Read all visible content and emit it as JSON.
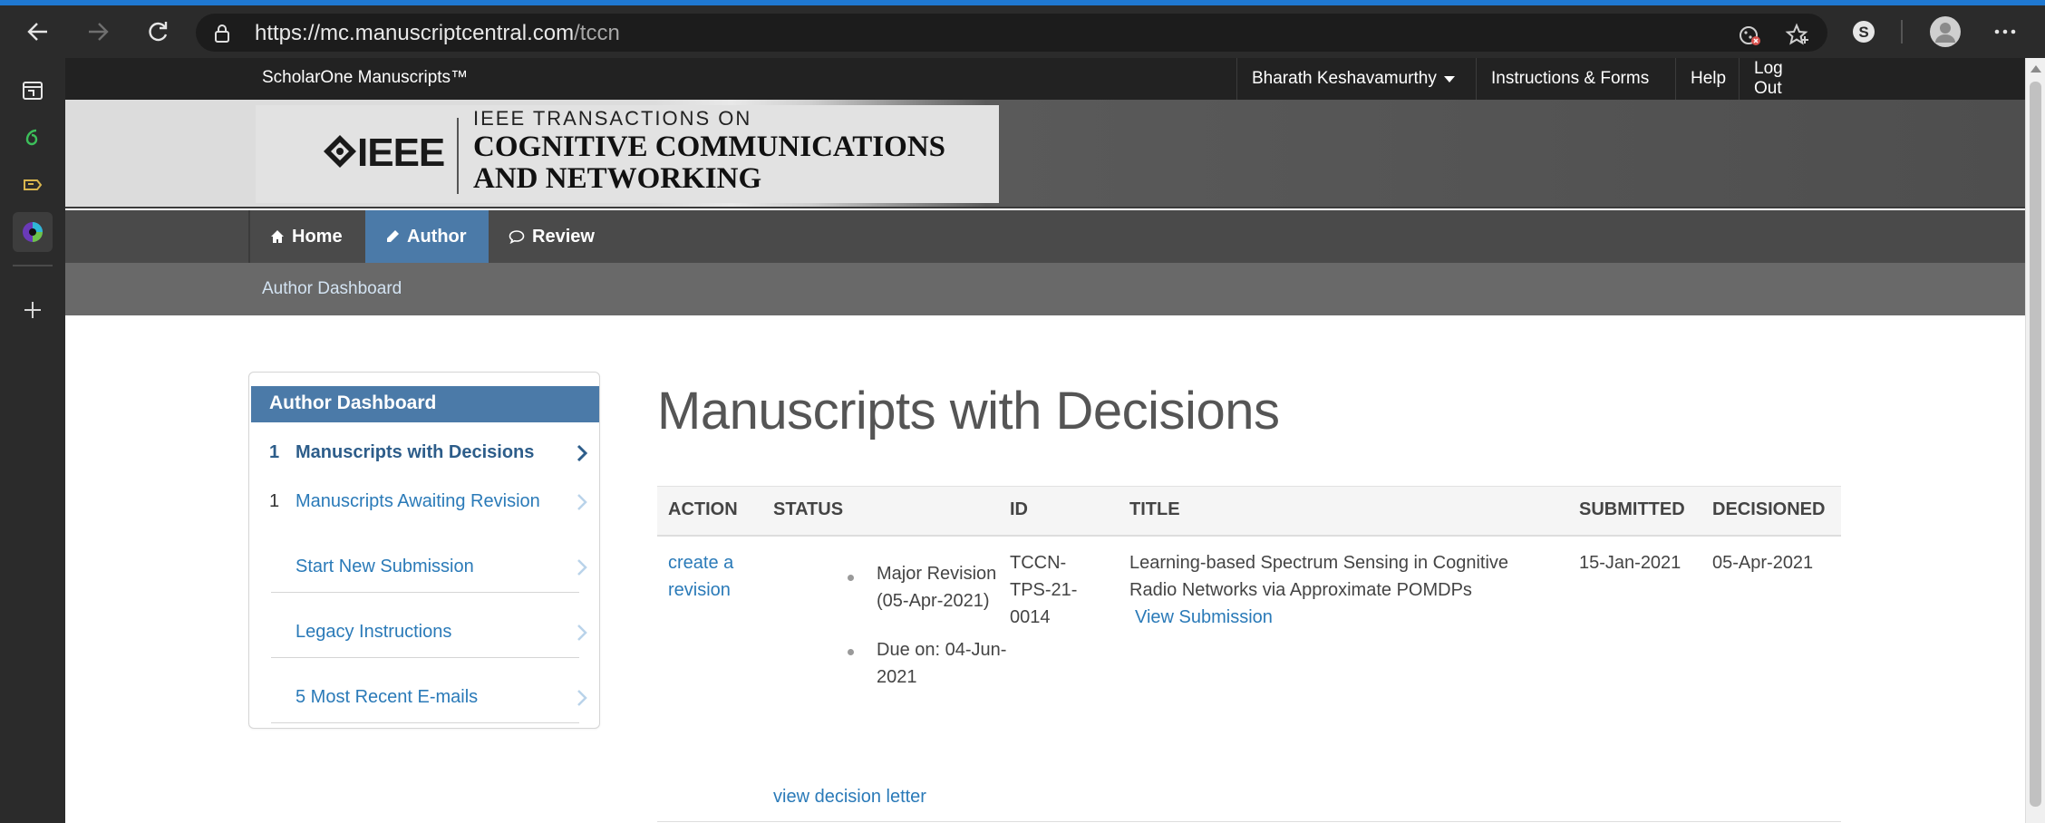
{
  "browser": {
    "url_host": "https://mc.manuscriptcentral.com",
    "url_path": "/tccn"
  },
  "site": {
    "brand": "ScholarOne Manuscripts™",
    "user_menu": "Bharath Keshavamurthy",
    "links": [
      "Instructions & Forms",
      "Help",
      "Log Out"
    ]
  },
  "banner": {
    "publisher": "IEEE",
    "journal_pre": "IEEE TRANSACTIONS ON",
    "journal_line1": "COGNITIVE COMMUNICATIONS",
    "journal_line2": "AND NETWORKING"
  },
  "nav": {
    "tabs": [
      {
        "label": "Home",
        "icon": "home-icon"
      },
      {
        "label": "Author",
        "icon": "pencil-icon",
        "active": true
      },
      {
        "label": "Review",
        "icon": "comment-icon"
      }
    ],
    "breadcrumb": "Author Dashboard"
  },
  "dashboard": {
    "title": "Author Dashboard",
    "items": [
      {
        "count": "1",
        "label": "Manuscripts with Decisions",
        "active": true
      },
      {
        "count": "1",
        "label": "Manuscripts Awaiting Revision"
      },
      {
        "count": "",
        "label": "Start New Submission"
      },
      {
        "count": "",
        "label": "Legacy Instructions"
      },
      {
        "count": "",
        "label": "5 Most Recent E-mails"
      }
    ]
  },
  "main": {
    "title": "Manuscripts with Decisions",
    "columns": [
      "ACTION",
      "STATUS",
      "ID",
      "TITLE",
      "SUBMITTED",
      "DECISIONED"
    ],
    "row": {
      "action_line1": "create a",
      "action_line2": "revision",
      "status1_line1": "Major Revision",
      "status1_line2": "(05-Apr-2021)",
      "status2_line1": "Due on: 04-Jun-",
      "status2_line2": "2021",
      "decision_letter": "view decision letter",
      "id_line1": "TCCN-",
      "id_line2": "TPS-21-",
      "id_line3": "0014",
      "title_line1": "Learning-based Spectrum Sensing in Cognitive",
      "title_line2": "Radio Networks via Approximate POMDPs",
      "view_submission": "View Submission",
      "submitted": "15-Jan-2021",
      "decisioned": "05-Apr-2021"
    }
  },
  "colors": {
    "accent": "#4b7aa8",
    "link": "#2a7ab8",
    "topbar": "#222222"
  }
}
